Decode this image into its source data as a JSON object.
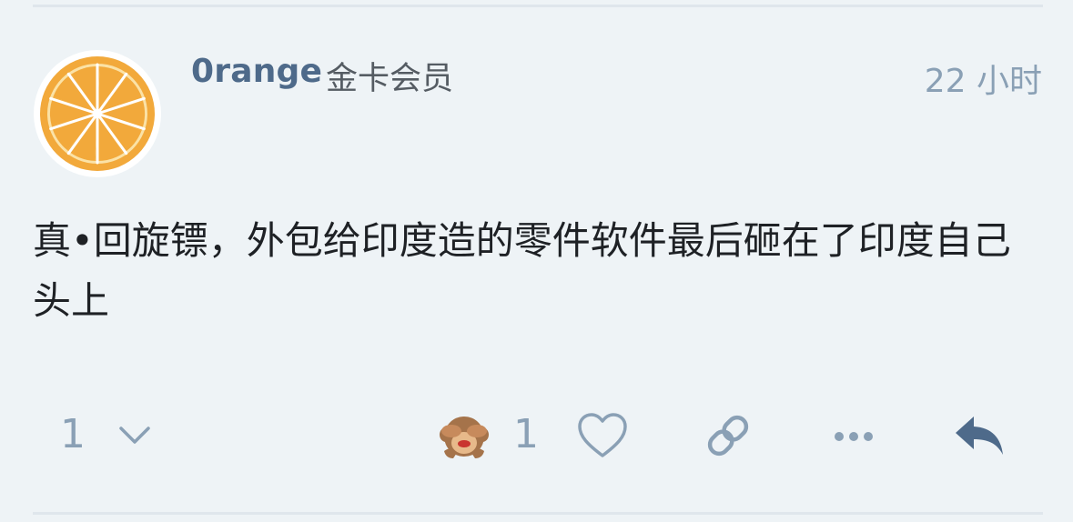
{
  "post": {
    "author": "0range",
    "badge": "金卡会员",
    "time": "22 小时",
    "content": "真•回旋镖，外包给印度造的零件软件最后砸在了印度自己头上"
  },
  "actions": {
    "vote_count": "1",
    "reaction_emoji": "see-no-evil-monkey",
    "reaction_count": "1",
    "icons": [
      "chevron-down-icon",
      "heart-icon",
      "link-icon",
      "more-icon",
      "reply-icon"
    ]
  },
  "colors": {
    "background": "#eef3f6",
    "username": "#4e6a8a",
    "muted": "#8aa0b5",
    "reply_accent": "#4e6a8a",
    "orange": "#f2a93b"
  }
}
